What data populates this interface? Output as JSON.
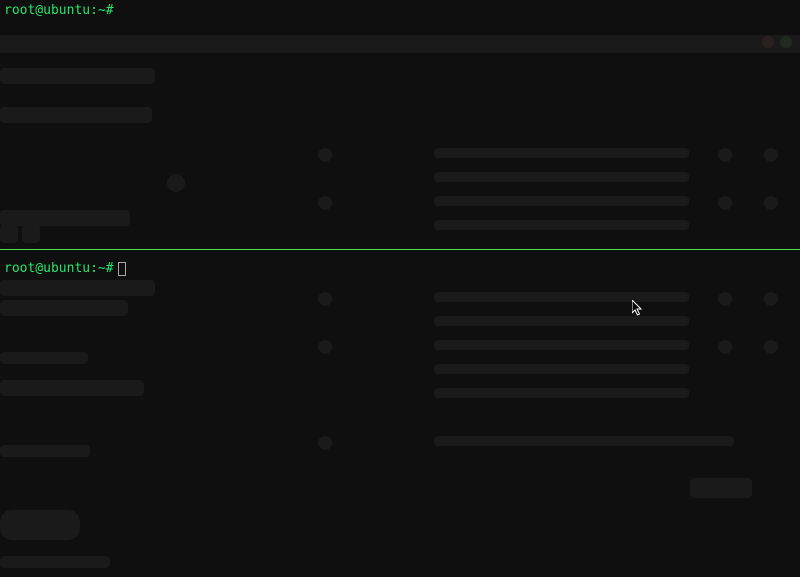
{
  "panes": {
    "top": {
      "prompt": "root@ubuntu:~#"
    },
    "bottom": {
      "prompt": "root@ubuntu:~#"
    }
  }
}
